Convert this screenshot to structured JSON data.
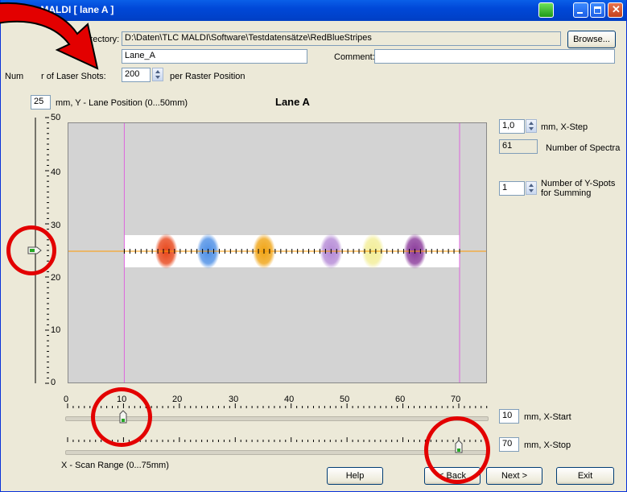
{
  "window": {
    "title": "TLC-MALDI  [ lane A ]"
  },
  "form": {
    "directory_label": "e Directory:",
    "directory_value": "D:\\Daten\\TLC MALDI\\Software\\Testdatensätze\\RedBlueStripes",
    "browse_label": "Browse...",
    "lane_value": "Lane_A",
    "comment_label": "Comment:",
    "comment_value": "",
    "shots_label_a": "Num",
    "shots_label_b": "r of Laser Shots:",
    "shots_value": "200",
    "shots_suffix": "per Raster Position"
  },
  "yaxis": {
    "position_value": "25",
    "position_label": "mm, Y - Lane Position (0...50mm)",
    "ticks": [
      "50",
      "40",
      "30",
      "20",
      "10",
      "0"
    ],
    "range": [
      0,
      50
    ],
    "slider_value": 25
  },
  "plot": {
    "title": "Lane A",
    "x_range": [
      0,
      75
    ],
    "x_start": 10,
    "x_stop": 70,
    "lane_y": 25,
    "spots": [
      {
        "x": 17.5,
        "color": "#e8461a"
      },
      {
        "x": 25,
        "color": "#4d8fe6"
      },
      {
        "x": 35,
        "color": "#f0a414"
      },
      {
        "x": 47,
        "color": "#b58ad6"
      },
      {
        "x": 54.5,
        "color": "#f3ee98"
      },
      {
        "x": 62,
        "color": "#8a3a9a"
      }
    ],
    "colors": {
      "lane": "#ff9900",
      "boundary": "#dd66dd",
      "background": "#d3d3d3"
    }
  },
  "right_panel": {
    "xstep_value": "1,0",
    "xstep_label": "mm, X-Step",
    "spectra_value": "61",
    "spectra_label": "Number of Spectra",
    "yspots_value": "1",
    "yspots_label_1": "Number of Y-Spots",
    "yspots_label_2": "for Summing"
  },
  "xaxis": {
    "ticks": [
      "0",
      "10",
      "20",
      "30",
      "40",
      "50",
      "60",
      "70"
    ],
    "start_value": "10",
    "start_label": "mm, X-Start",
    "stop_value": "70",
    "stop_label": "mm, X-Stop",
    "range_label": "X - Scan Range (0...75mm)"
  },
  "buttons": {
    "help": "Help",
    "back": "< Back",
    "next": "Next >",
    "exit": "Exit"
  },
  "annotation_color": "#e30000"
}
